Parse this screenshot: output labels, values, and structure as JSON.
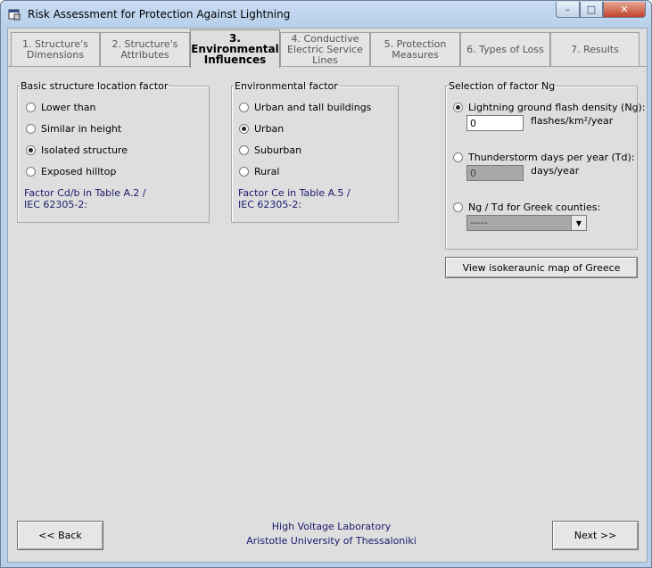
{
  "window": {
    "title": "Risk Assessment for Protection Against Lightning",
    "controls": {
      "minimize": "–",
      "maximize": "□",
      "close": "✕"
    }
  },
  "tabs": [
    {
      "label": "1. Structure's Dimensions",
      "active": false
    },
    {
      "label": "2. Structure's Attributes",
      "active": false
    },
    {
      "label": "3. Environmental Influences",
      "active": true
    },
    {
      "label": "4. Conductive Electric Service Lines",
      "active": false
    },
    {
      "label": "5. Protection Measures",
      "active": false
    },
    {
      "label": "6. Types of Loss",
      "active": false
    },
    {
      "label": "7. Results",
      "active": false
    }
  ],
  "location_factor": {
    "title": "Basic structure location factor",
    "options": [
      {
        "label": "Lower than",
        "selected": false
      },
      {
        "label": "Similar in height",
        "selected": false
      },
      {
        "label": "Isolated structure",
        "selected": true
      },
      {
        "label": "Exposed hilltop",
        "selected": false
      }
    ],
    "note_line1": "Factor Cd/b in Table A.2 /",
    "note_line2": "IEC 62305-2:"
  },
  "environmental_factor": {
    "title": "Environmental factor",
    "options": [
      {
        "label": "Urban and tall buildings",
        "selected": false
      },
      {
        "label": "Urban",
        "selected": true
      },
      {
        "label": "Suburban",
        "selected": false
      },
      {
        "label": "Rural",
        "selected": false
      }
    ],
    "note_line1": "Factor Ce in Table A.5 /",
    "note_line2": "IEC 62305-2:"
  },
  "ng_selection": {
    "title": "Selection of factor Ng",
    "ng_option": {
      "label": "Lightning ground flash density (Ng):",
      "selected": true,
      "value": "0",
      "unit": "flashes/km²/year"
    },
    "td_option": {
      "label": "Thunderstorm days per year (Td):",
      "selected": false,
      "value": "0",
      "unit": "days/year"
    },
    "greek_option": {
      "label": "Ng / Td for Greek counties:",
      "selected": false,
      "value": "-----"
    }
  },
  "map_button": "View isokeraunic map of Greece",
  "footer": {
    "line1": "High Voltage Laboratory",
    "line2": "Aristotle University of Thessaloniki"
  },
  "back_button": "<< Back",
  "next_button": "Next >>"
}
